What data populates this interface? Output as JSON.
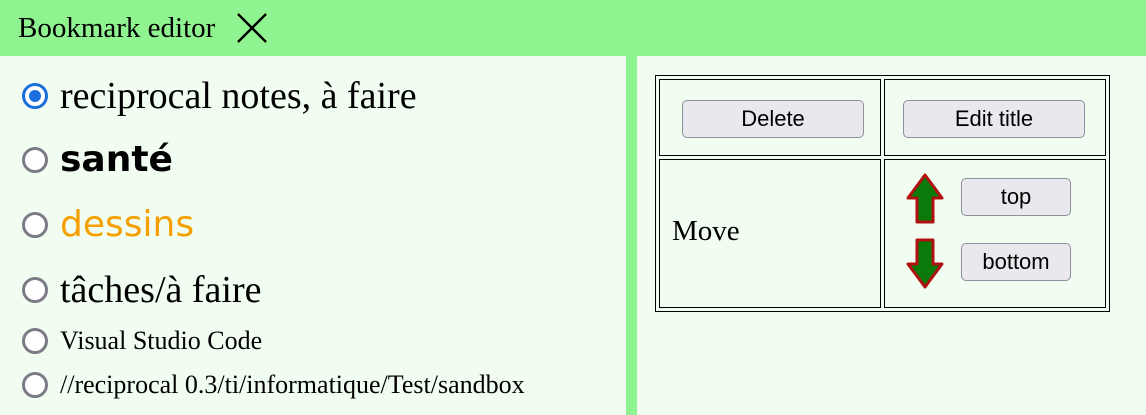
{
  "window": {
    "title": "Bookmark editor"
  },
  "bookmarks": [
    {
      "label": "reciprocal notes, à faire",
      "checked": true,
      "color": "#000000"
    },
    {
      "label": "santé",
      "checked": false,
      "color": "#000000"
    },
    {
      "label": "dessins",
      "checked": false,
      "color": "#f5a000"
    },
    {
      "label": "tâches/à faire",
      "checked": false,
      "color": "#000000"
    },
    {
      "label": "Visual Studio Code",
      "checked": false,
      "color": "#000000"
    },
    {
      "label": "//reciprocal 0.3/ti/informatique/Test/sandbox",
      "checked": false,
      "color": "#000000"
    }
  ],
  "actions": {
    "delete_label": "Delete",
    "edit_title_label": "Edit title",
    "move_label": "Move",
    "top_label": "top",
    "bottom_label": "bottom"
  },
  "icons": {
    "close": "close-icon",
    "up": "arrow-up-icon",
    "down": "arrow-down-icon"
  },
  "colors": {
    "background": "#8ff38f",
    "panel": "#f2fdf2",
    "radio_checked": "#1a6fdc",
    "arrow_fill": "#0a7a0a",
    "arrow_stroke": "#b01010"
  }
}
